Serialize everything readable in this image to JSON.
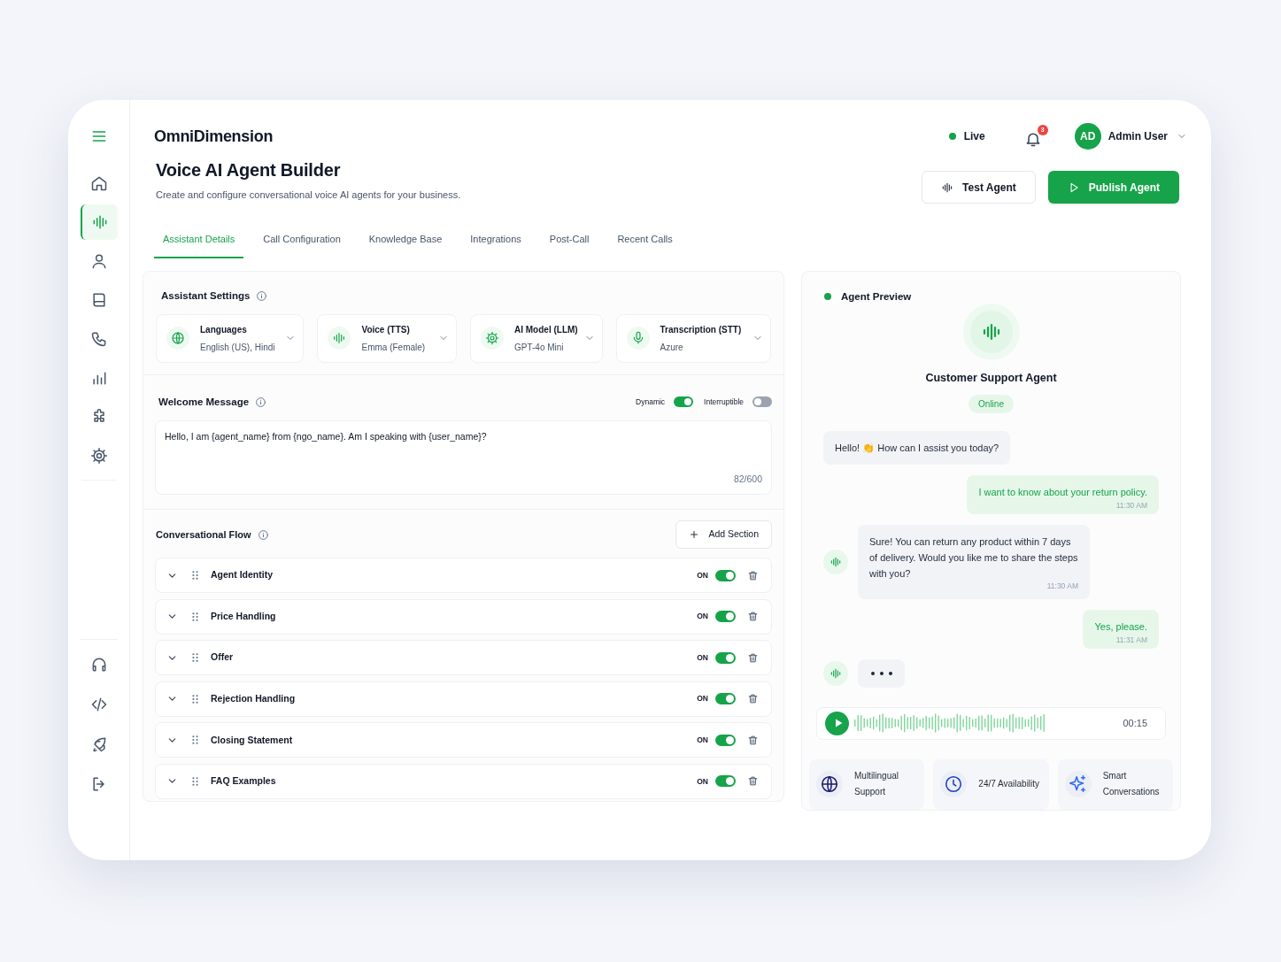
{
  "sidebar": {
    "items": [
      {
        "kind": "menu",
        "selected": false
      },
      {
        "kind": "home",
        "selected": false
      },
      {
        "kind": "wave",
        "selected": true
      },
      {
        "kind": "user",
        "selected": false
      },
      {
        "kind": "book",
        "selected": false
      },
      {
        "kind": "phone",
        "selected": false
      },
      {
        "kind": "chart",
        "selected": false
      },
      {
        "kind": "puzzle",
        "selected": false
      },
      {
        "kind": "gear",
        "selected": false
      }
    ],
    "bottom_items": [
      {
        "kind": "headset",
        "selected": false
      },
      {
        "kind": "code",
        "selected": false
      },
      {
        "kind": "rocket",
        "selected": false
      },
      {
        "kind": "logout",
        "selected": false
      }
    ]
  },
  "header": {
    "brand": "OmniDimension",
    "status": {
      "label": "Live"
    },
    "notifications": {
      "count": "3"
    },
    "user": {
      "initials": "AD",
      "name": "Admin User"
    }
  },
  "page": {
    "title": "Voice AI Agent Builder",
    "subtitle": "Create and configure conversational voice AI agents for your business.",
    "actions": [
      {
        "kind": "outline",
        "label": "Test Agent"
      },
      {
        "kind": "primary",
        "label": "Publish Agent"
      }
    ]
  },
  "tabs": [
    {
      "label": "Assistant Details",
      "selected": true
    },
    {
      "label": "Call Configuration",
      "selected": false
    },
    {
      "label": "Knowledge Base",
      "selected": false
    },
    {
      "label": "Integrations",
      "selected": false
    },
    {
      "label": "Post-Call",
      "selected": false
    },
    {
      "label": "Recent Calls",
      "selected": false
    }
  ],
  "settings": {
    "title": "Assistant Settings",
    "fields": [
      {
        "kind": "globe",
        "label": "Languages",
        "value": "English (US), Hindi"
      },
      {
        "kind": "wave",
        "label": "Voice (TTS)",
        "value": "Emma (Female)"
      },
      {
        "kind": "gear",
        "label": "AI Model (LLM)",
        "value": "GPT-4o Mini"
      },
      {
        "kind": "mic",
        "label": "Transcription (STT)",
        "value": "Azure"
      }
    ]
  },
  "welcome": {
    "title": "Welcome Message",
    "toggles": [
      {
        "label": "Dynamic",
        "on": true
      },
      {
        "label": "Interruptible",
        "on": false
      }
    ],
    "text": "Hello, I am {agent_name} from {ngo_name}. Am I speaking with {user_name}?",
    "counter": "82/600"
  },
  "flow": {
    "title": "Conversational Flow",
    "add_label": "Add Section",
    "sections": [
      {
        "name": "Agent Identity",
        "state": "ON",
        "on": true
      },
      {
        "name": "Price Handling",
        "state": "ON",
        "on": true
      },
      {
        "name": "Offer",
        "state": "ON",
        "on": true
      },
      {
        "name": "Rejection Handling",
        "state": "ON",
        "on": true
      },
      {
        "name": "Closing Statement",
        "state": "ON",
        "on": true
      },
      {
        "name": "FAQ Examples",
        "state": "ON",
        "on": true
      }
    ]
  },
  "preview": {
    "title": "Agent Preview",
    "agent_name": "Customer Support Agent",
    "status": "Online",
    "messages": [
      {
        "kind": "agent",
        "avatar": false,
        "text": "Hello! 👏 How can I assist you today?"
      },
      {
        "kind": "user",
        "avatar": false,
        "text": "I want to know about your return policy.",
        "time": "11:30 AM"
      },
      {
        "kind": "agent",
        "avatar": true,
        "text": "Sure! You can return any product within 7 days of delivery. Would you like me to share the steps with you?",
        "time": "11:30 AM"
      },
      {
        "kind": "user",
        "avatar": false,
        "text": "Yes, please.",
        "time": "11:31 AM"
      },
      {
        "kind": "typing",
        "avatar": true
      }
    ],
    "audio": {
      "duration": "00:15"
    },
    "features": [
      {
        "kind": "globe",
        "label": "Multilingual Support"
      },
      {
        "kind": "clock",
        "label": "24/7 Availability"
      },
      {
        "kind": "sparkle",
        "label": "Smart Conversations"
      }
    ]
  }
}
